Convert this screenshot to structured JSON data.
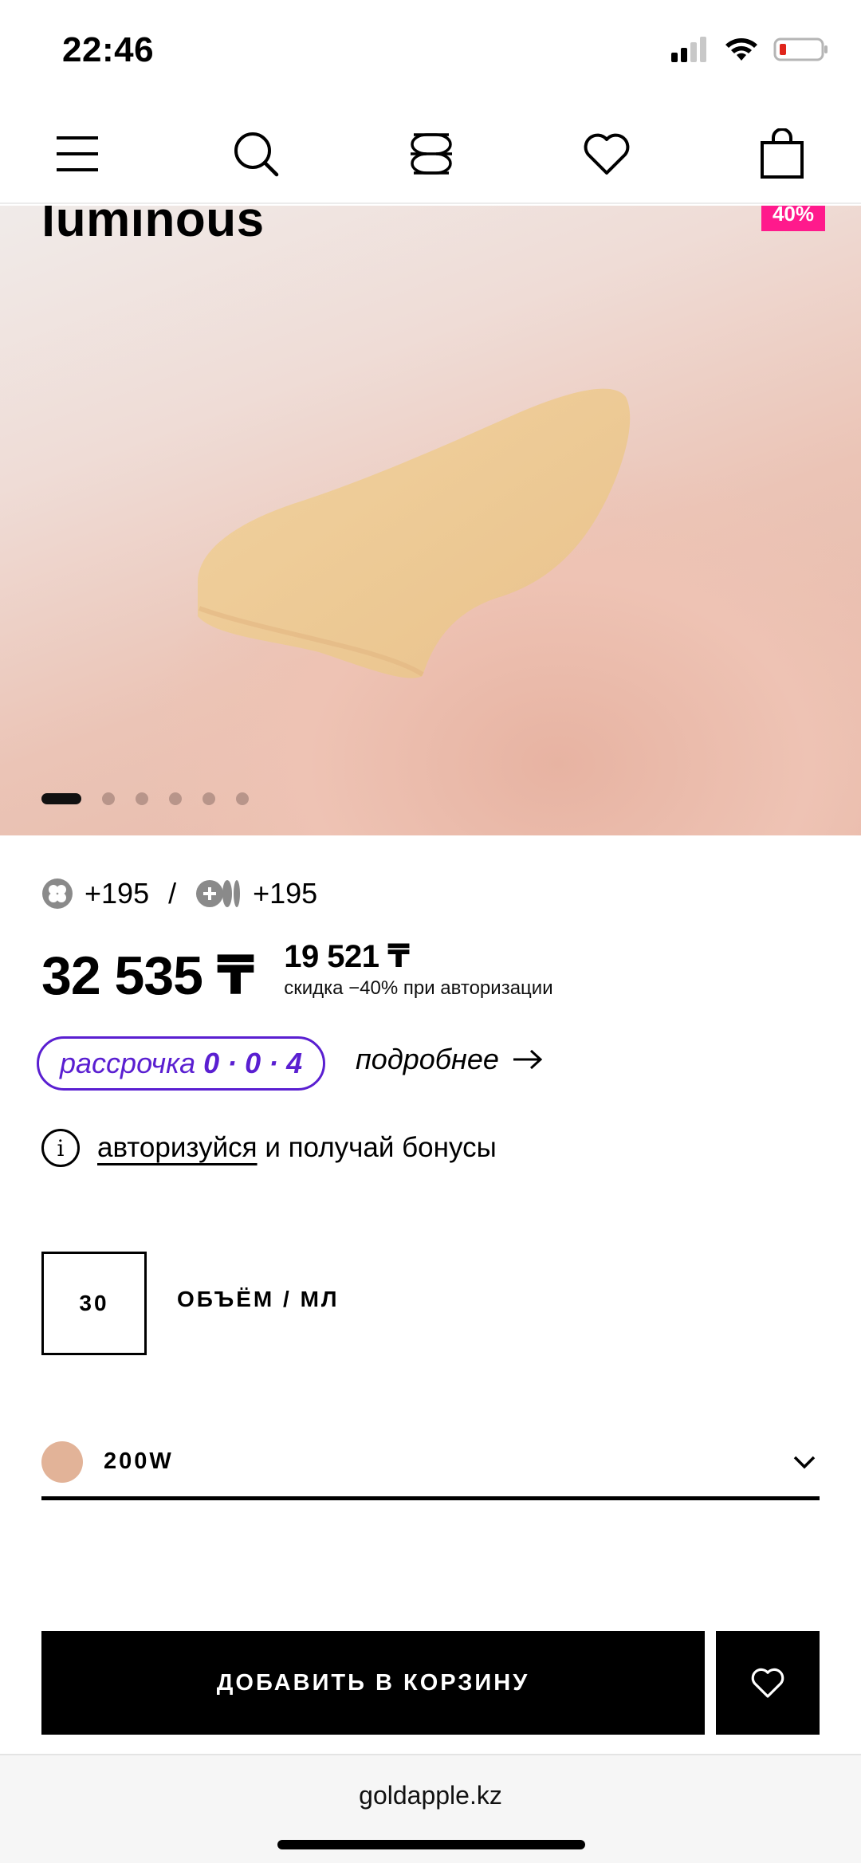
{
  "status_bar": {
    "time": "22:46"
  },
  "nav": {
    "icons": [
      "menu-icon",
      "search-icon",
      "brand-logo-icon",
      "heart-icon",
      "bag-icon"
    ]
  },
  "product": {
    "title_fragment": "luminous",
    "discount_badge": "40%",
    "gallery": {
      "total_images": 6,
      "active_index": 0
    }
  },
  "bonuses": {
    "a": "+195",
    "separator": "/",
    "b": "+195"
  },
  "price": {
    "current": "32 535 ₸",
    "auth_price": "19 521 ₸",
    "auth_note": "скидка −40% при авторизации"
  },
  "installment": {
    "label": "рассрочка",
    "plan": "0 · 0 · 4",
    "more": "подробнее"
  },
  "auth_hint": {
    "link": "авторизуйся",
    "rest": "и получай бонусы"
  },
  "volume": {
    "value": "30",
    "label": "ОБЪЁМ / МЛ"
  },
  "shade": {
    "name": "200W",
    "color": "#e2b398"
  },
  "actions": {
    "add_to_cart": "ДОБАВИТЬ В КОРЗИНУ"
  },
  "browser": {
    "url": "goldapple.kz"
  },
  "colors": {
    "installment_accent": "#5a1fd1",
    "badge": "#ff1a8c"
  }
}
